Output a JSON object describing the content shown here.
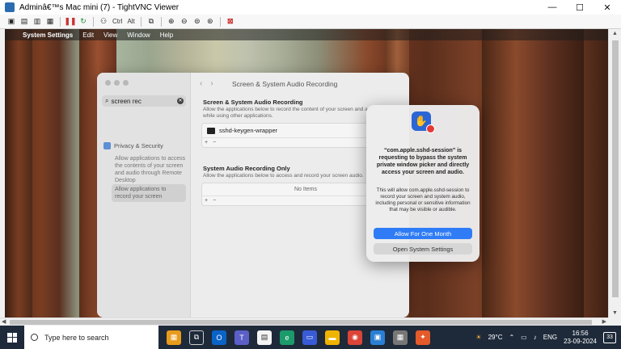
{
  "vnc": {
    "title": "Adminâ€™s Mac mini (7) - TightVNC Viewer",
    "minimize": "—",
    "maximize": "☐",
    "close": "✕",
    "toolbar_ctrl": "Ctrl",
    "toolbar_alt": "Alt"
  },
  "mac_menu": {
    "apple": "",
    "app": "System Settings",
    "items": [
      "Edit",
      "View",
      "Window",
      "Help"
    ]
  },
  "settings": {
    "search_value": "screen rec",
    "sidebar_head": "Privacy & Security",
    "sidebar_sub": "Allow applications to access the contents of your screen and audio through Remote Desktop",
    "sidebar_selected": "Allow applications to record your screen",
    "page_title": "Screen & System Audio Recording",
    "section1_title": "Screen & System Audio Recording",
    "section1_desc": "Allow the applications below to record the content of your screen and a while using other applications.",
    "app_row": "sshd-keygen-wrapper",
    "add": "+",
    "remove": "−",
    "section2_title": "System Audio Recording Only",
    "section2_desc": "Allow the applications below to access and record your screen audio.",
    "no_items": "No Items"
  },
  "dialog": {
    "title": "“com.apple.sshd-session” is requesting to bypass the system private window picker and directly access your screen and audio.",
    "body": "This will allow com.apple.sshd-session to record your screen and system audio, including personal or sensitive information that may be visible or audible.",
    "primary": "Allow For One Month",
    "secondary": "Open System Settings"
  },
  "taskbar": {
    "search_placeholder": "Type here to search",
    "weather": "29°C",
    "lang": "ENG",
    "time": "16:56",
    "date": "23-09-2024",
    "notifications": "33"
  },
  "colors": {
    "accent": "#2f7cf6",
    "taskbar": "#1e2a3a"
  }
}
